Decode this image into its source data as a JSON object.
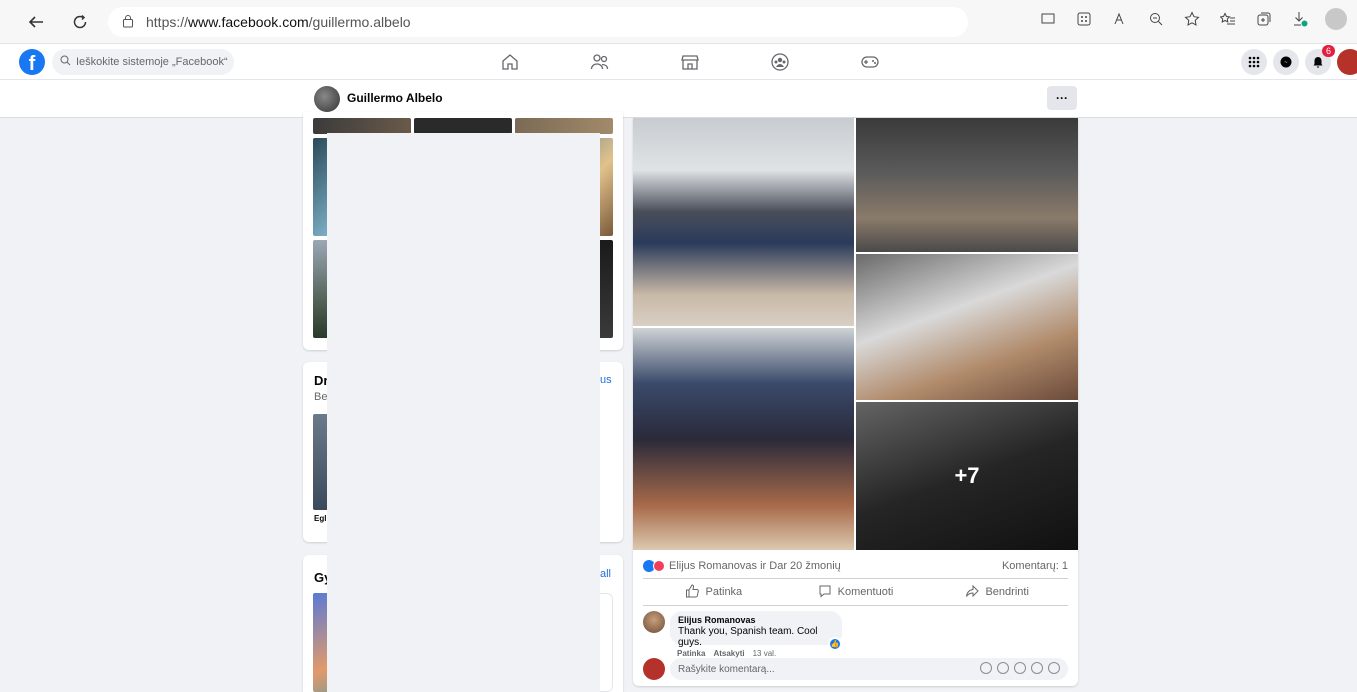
{
  "browser": {
    "url_prefix": "https://",
    "url_domain": "www.facebook.com",
    "url_path": "/guillermo.albelo"
  },
  "fb": {
    "logo_letter": "f",
    "search_placeholder": "Ieškokite sistemoje „Facebook“",
    "notifications_count": "6"
  },
  "profile": {
    "name": "Guillermo Albelo",
    "more_label": "···"
  },
  "left_cards": {
    "friends_title": "Dr",
    "friends_sub": "Be",
    "friends_link": "us",
    "friend_name": "Egl",
    "second_title": "Gy",
    "second_link": "all"
  },
  "post": {
    "more_photos": "+7",
    "reactions_text": "Elijus Romanovas ir Dar 20 žmonių",
    "comments_count": "Komentarų: 1",
    "actions": {
      "like": "Patinka",
      "comment": "Komentuoti",
      "share": "Bendrinti"
    },
    "comment": {
      "author": "Elijus Romanovas",
      "text": "Thank you, Spanish team. Cool guys.",
      "like_label": "Patinka",
      "reply_label": "Atsakyti",
      "time": "13 val."
    },
    "write_placeholder": "Rašykite komentarą..."
  },
  "colors": {
    "fb_blue": "#1877f2",
    "background": "#f0f2f5",
    "love_red": "#f33e58"
  }
}
